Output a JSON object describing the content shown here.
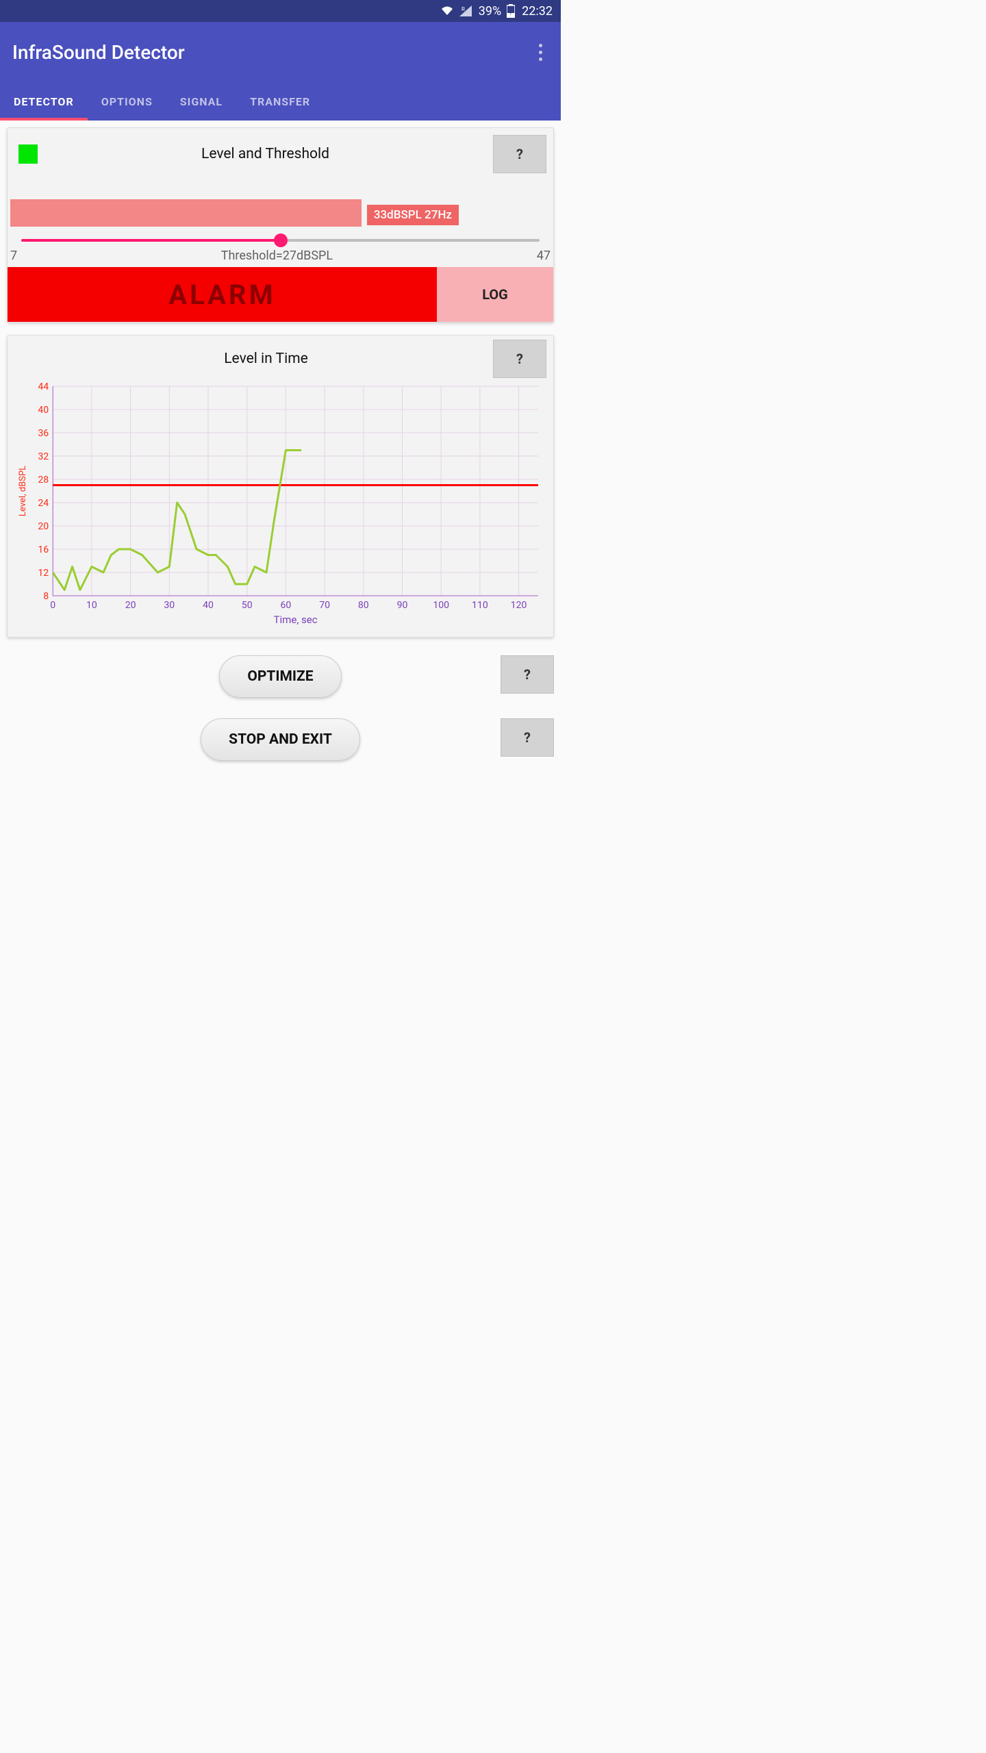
{
  "status": {
    "battery": "39%",
    "time": "22:32"
  },
  "app": {
    "title": "InfraSound Detector"
  },
  "tabs": [
    {
      "label": "DETECTOR",
      "active": true
    },
    {
      "label": "OPTIONS",
      "active": false
    },
    {
      "label": "SIGNAL",
      "active": false
    },
    {
      "label": "TRANSFER",
      "active": false
    }
  ],
  "threshold_card": {
    "title": "Level and Threshold",
    "help": "?",
    "level_badge": "33dBSPL 27Hz",
    "level_bar_pct": 65,
    "slider": {
      "min": 7,
      "max": 47,
      "value": 27
    },
    "threshold_label": "Threshold=27dBSPL",
    "alarm": "ALARM",
    "log": "LOG"
  },
  "chart_card": {
    "title": "Level in Time",
    "help": "?"
  },
  "chart_data": {
    "type": "line",
    "title": "Level in Time",
    "xlabel": "Time, sec",
    "ylabel": "Level, dBSPL",
    "xlim": [
      0,
      125
    ],
    "ylim": [
      8,
      44
    ],
    "x_ticks": [
      0,
      10,
      20,
      30,
      40,
      50,
      60,
      70,
      80,
      90,
      100,
      110,
      120
    ],
    "y_ticks": [
      8,
      12,
      16,
      20,
      24,
      28,
      32,
      36,
      40,
      44
    ],
    "threshold": 27,
    "x": [
      0,
      3,
      5,
      7,
      10,
      13,
      15,
      17,
      20,
      23,
      27,
      30,
      32,
      34,
      37,
      40,
      42,
      45,
      47,
      50,
      52,
      55,
      57,
      60,
      64
    ],
    "values": [
      12,
      9,
      13,
      9,
      13,
      12,
      15,
      16,
      16,
      15,
      12,
      13,
      24,
      22,
      16,
      15,
      15,
      13,
      10,
      10,
      13,
      12,
      21,
      33,
      33
    ]
  },
  "buttons": {
    "optimize": "OPTIMIZE",
    "stop": "STOP AND EXIT",
    "help": "?"
  }
}
